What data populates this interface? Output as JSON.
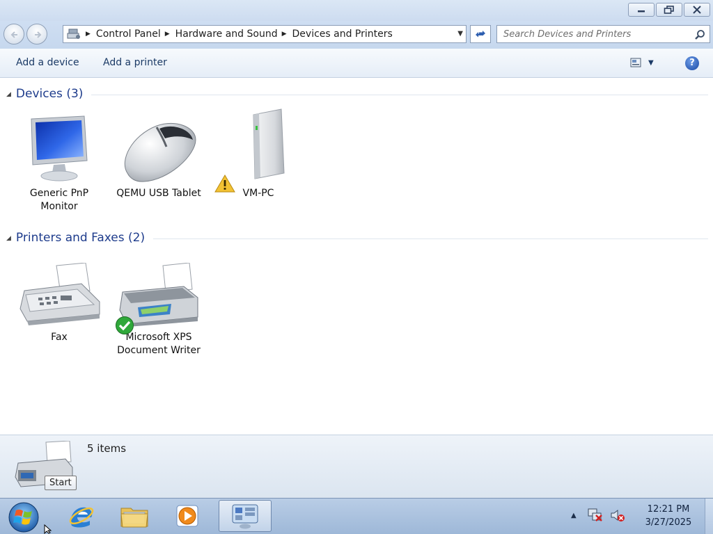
{
  "window": {
    "controls": {
      "minimize_icon": "minimize-icon",
      "restore_icon": "restore-icon",
      "close_icon": "close-icon"
    }
  },
  "address_bar": {
    "breadcrumbs": [
      "Control Panel",
      "Hardware and Sound",
      "Devices and Printers"
    ],
    "search_placeholder": "Search Devices and Printers"
  },
  "command_bar": {
    "add_device_label": "Add a device",
    "add_printer_label": "Add a printer",
    "help_label": "?"
  },
  "groups": {
    "devices": {
      "title": "Devices (3)",
      "items": [
        {
          "label": "Generic PnP Monitor",
          "icon": "monitor-icon"
        },
        {
          "label": "QEMU USB Tablet",
          "icon": "mouse-icon"
        },
        {
          "label": "VM-PC",
          "icon": "computer-icon",
          "badge": "warning-icon"
        }
      ]
    },
    "printers": {
      "title": "Printers and Faxes (2)",
      "items": [
        {
          "label": "Fax",
          "icon": "fax-icon"
        },
        {
          "label": "Microsoft XPS Document Writer",
          "icon": "printer-icon",
          "badge": "default-check-icon"
        }
      ]
    }
  },
  "details_pane": {
    "count": "5 items",
    "tooltip": "Start"
  },
  "taskbar": {
    "pinned": [
      "internet-explorer-icon",
      "windows-explorer-icon",
      "media-player-icon",
      "devices-and-printers-icon"
    ],
    "tray_icons": [
      "show-hidden-icons-arrow",
      "network-icon",
      "volume-muted-icon"
    ],
    "time": "12:21 PM",
    "date": "3/27/2025"
  },
  "colors": {
    "accent_text": "#1e3c8c",
    "taskbar": "#9eb8d8"
  }
}
